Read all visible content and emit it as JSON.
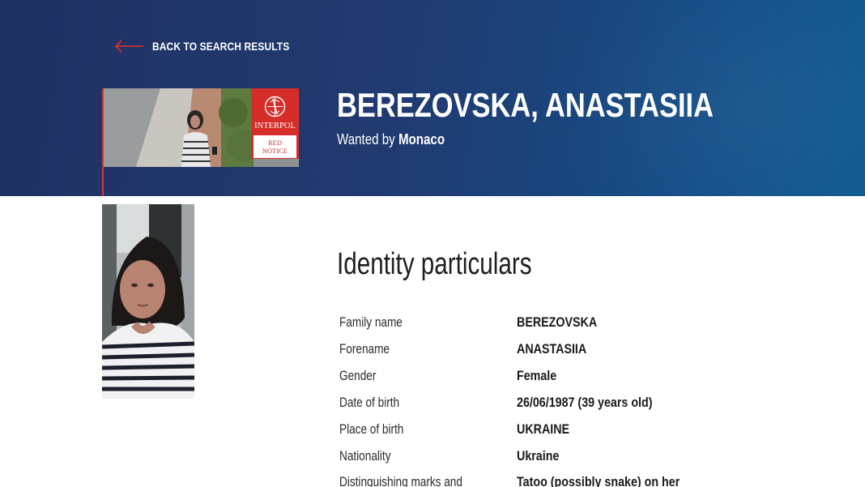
{
  "nav": {
    "back_label": "BACK TO SEARCH RESULTS"
  },
  "notice": {
    "name": "BEREZOVSKA, ANASTASIIA",
    "wanted_prefix": "Wanted by",
    "wanted_country": "Monaco",
    "badge_org": "INTERPOL",
    "badge_line1": "RED",
    "badge_line2": "NOTICE",
    "badge_color": "#d72d28"
  },
  "identity": {
    "title": "Identity particulars",
    "rows": [
      {
        "label": "Family name",
        "value": "BEREZOVSKA"
      },
      {
        "label": "Forename",
        "value": "ANASTASIIA"
      },
      {
        "label": "Gender",
        "value": "Female"
      },
      {
        "label": "Date of birth",
        "value": "26/06/1987 (39 years old)"
      },
      {
        "label": "Place of birth",
        "value": "UKRAINE"
      },
      {
        "label": "Nationality",
        "value": "Ukraine"
      },
      {
        "label": "Distinguishing marks and",
        "value": "Tatoo (possibly snake) on her"
      }
    ]
  },
  "colors": {
    "header_dark": "#1f3163",
    "header_light": "#0f5a8f",
    "accent_red": "#e0332b"
  }
}
